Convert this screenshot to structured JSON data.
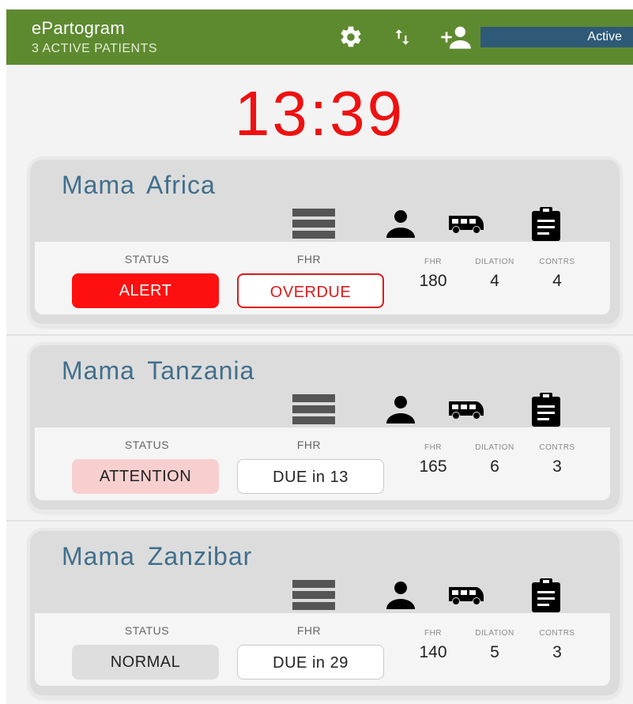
{
  "app": {
    "title": "ePartogram",
    "subtitle": "3 ACTIVE PATIENTS",
    "active_label": "Active"
  },
  "clock": "13:39",
  "icons": {
    "settings": "gear-icon",
    "sort": "swap-vertical-icon",
    "add_patient": "person-add-icon",
    "chart": "partograph-bars-icon",
    "person": "person-icon",
    "transport": "bus-icon",
    "notes": "clipboard-icon"
  },
  "colors": {
    "appbar": "#5d8a2f",
    "active_pill": "#2e5a78",
    "clock": "#ee1111",
    "patient_name": "#416f8c",
    "alert": "#ff1010",
    "attention": "#f7cfcf",
    "normal": "#dedede",
    "overdue": "#dd1a1a"
  },
  "labels": {
    "status": "STATUS",
    "fhr": "FHR",
    "fhr_small": "FHR",
    "dilation": "DILATION",
    "contrs": "CONTRS"
  },
  "patients": [
    {
      "name": "Mama  Africa",
      "status": "ALERT",
      "status_level": "alert",
      "fhr_due": "OVERDUE",
      "fhr_state": "overdue",
      "fhr": "180",
      "dilation": "4",
      "contrs": "4"
    },
    {
      "name": "Mama  Tanzania",
      "status": "ATTENTION",
      "status_level": "attention",
      "fhr_due": "DUE in 13",
      "fhr_state": "due",
      "fhr": "165",
      "dilation": "6",
      "contrs": "3"
    },
    {
      "name": "Mama  Zanzibar",
      "status": "NORMAL",
      "status_level": "normal",
      "fhr_due": "DUE in 29",
      "fhr_state": "due",
      "fhr": "140",
      "dilation": "5",
      "contrs": "3"
    }
  ]
}
